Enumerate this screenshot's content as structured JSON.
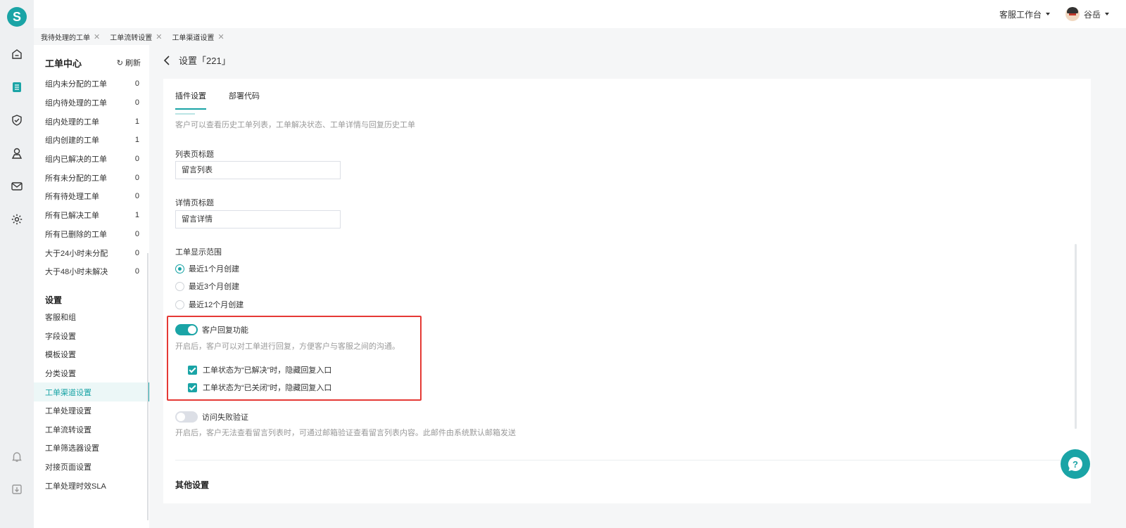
{
  "brand": {
    "logo_letter": "S",
    "accent_color": "#1aa4a6",
    "highlight_color": "#e53935"
  },
  "rail": {
    "icons": [
      "home-icon",
      "document-list-icon",
      "shield-check-icon",
      "user-pin-icon",
      "mail-icon",
      "gear-icon",
      "bell-icon",
      "download-icon"
    ]
  },
  "topbar": {
    "workspace": "客服工作台",
    "user_name": "谷岳"
  },
  "tabs": [
    {
      "label": "我待处理的工单"
    },
    {
      "label": "工单流转设置"
    },
    {
      "label": "工单渠道设置"
    }
  ],
  "sidebar": {
    "title": "工单中心",
    "refresh_label": "刷新",
    "items": [
      {
        "label": "组内未分配的工单",
        "count": "0"
      },
      {
        "label": "组内待处理的工单",
        "count": "0"
      },
      {
        "label": "组内处理的工单",
        "count": "1"
      },
      {
        "label": "组内创建的工单",
        "count": "1"
      },
      {
        "label": "组内已解决的工单",
        "count": "0"
      },
      {
        "label": "所有未分配的工单",
        "count": "0"
      },
      {
        "label": "所有待处理工单",
        "count": "0"
      },
      {
        "label": "所有已解决工单",
        "count": "1"
      },
      {
        "label": "所有已删除的工单",
        "count": "0"
      },
      {
        "label": "大于24小时未分配",
        "count": "0"
      },
      {
        "label": "大于48小时未解决",
        "count": "0"
      }
    ],
    "settings_title": "设置",
    "settings": [
      {
        "label": "客服和组"
      },
      {
        "label": "字段设置"
      },
      {
        "label": "模板设置"
      },
      {
        "label": "分类设置"
      },
      {
        "label": "工单渠道设置"
      },
      {
        "label": "工单处理设置"
      },
      {
        "label": "工单流转设置"
      },
      {
        "label": "工单筛选器设置"
      },
      {
        "label": "对接页面设置"
      },
      {
        "label": "工单处理时效SLA"
      }
    ]
  },
  "page": {
    "title": "设置「221」",
    "tabs": [
      "插件设置",
      "部署代码"
    ],
    "intro": "客户可以查看历史工单列表，工单解决状态、工单详情与回复历史工单",
    "list_title_label": "列表页标题",
    "list_title_value": "留言列表",
    "detail_title_label": "详情页标题",
    "detail_title_value": "留言详情",
    "range_label": "工单显示范围",
    "range_options": [
      "最近1个月创建",
      "最近3个月创建",
      "最近12个月创建"
    ],
    "range_selected": "最近1个月创建",
    "reply": {
      "label": "客户回复功能",
      "enabled": true,
      "desc": "开启后，客户可以对工单进行回复，方便客户与客服之间的沟通。",
      "options": [
        "工单状态为“已解决”时，隐藏回复入口",
        "工单状态为“已关闭”时，隐藏回复入口"
      ]
    },
    "verify": {
      "label": "访问失败验证",
      "enabled": false,
      "desc": "开启后，客户无法查看留言列表时，可通过邮箱验证查看留言列表内容。此邮件由系统默认邮箱发送"
    },
    "other_title": "其他设置"
  }
}
